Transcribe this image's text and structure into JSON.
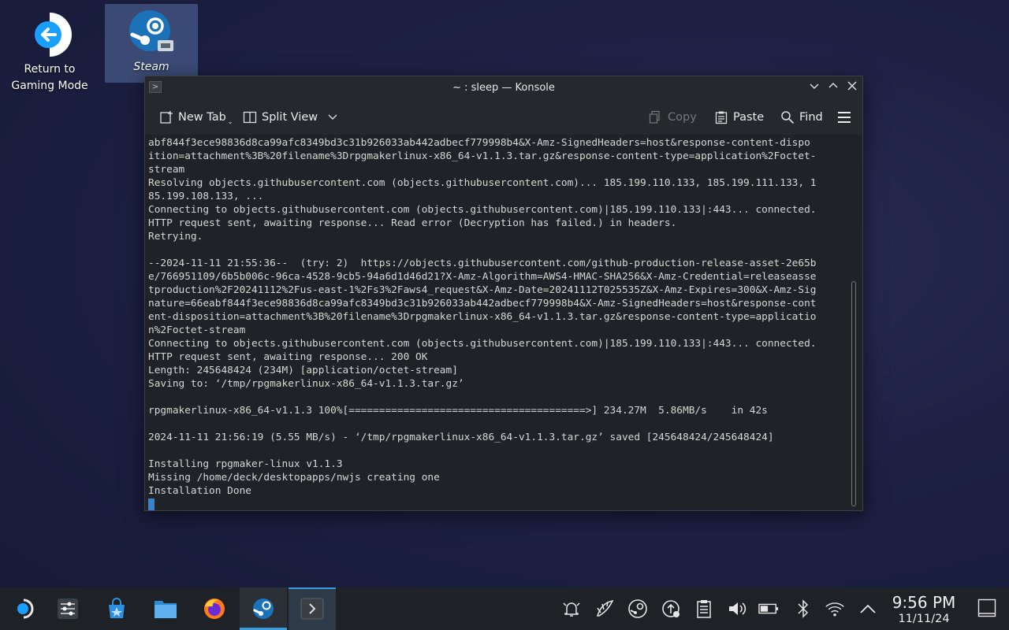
{
  "desktop": {
    "return_label_line1": "Return to",
    "return_label_line2": "Gaming Mode",
    "steam_label": "Steam"
  },
  "window": {
    "title": "~ : sleep — Konsole"
  },
  "toolbar": {
    "new_tab": "New Tab",
    "split_view": "Split View",
    "copy": "Copy",
    "paste": "Paste",
    "find": "Find"
  },
  "terminal": {
    "lines": [
      "abf844f3ece98836d8ca99afc8349bd3c31b926033ab442adbecf779998b4&X-Amz-SignedHeaders=host&response-content-dispo",
      "ition=attachment%3B%20filename%3Drpgmakerlinux-x86_64-v1.1.3.tar.gz&response-content-type=application%2Foctet-",
      "stream",
      "Resolving objects.githubusercontent.com (objects.githubusercontent.com)... 185.199.110.133, 185.199.111.133, 1",
      "85.199.108.133, ...",
      "Connecting to objects.githubusercontent.com (objects.githubusercontent.com)|185.199.110.133|:443... connected.",
      "HTTP request sent, awaiting response... Read error (Decryption has failed.) in headers.",
      "Retrying.",
      "",
      "--2024-11-11 21:55:36--  (try: 2)  https://objects.githubusercontent.com/github-production-release-asset-2e65b",
      "e/766951109/6b5b006c-96ca-4528-9cb5-94a6d1d46d21?X-Amz-Algorithm=AWS4-HMAC-SHA256&X-Amz-Credential=releaseasse",
      "tproduction%2F20241112%2Fus-east-1%2Fs3%2Faws4_request&X-Amz-Date=20241112T025535Z&X-Amz-Expires=300&X-Amz-Sig",
      "nature=66eabf844f3ece98836d8ca99afc8349bd3c31b926033ab442adbecf779998b4&X-Amz-SignedHeaders=host&response-cont",
      "ent-disposition=attachment%3B%20filename%3Drpgmakerlinux-x86_64-v1.1.3.tar.gz&response-content-type=applicatio",
      "n%2Foctet-stream",
      "Connecting to objects.githubusercontent.com (objects.githubusercontent.com)|185.199.110.133|:443... connected.",
      "HTTP request sent, awaiting response... 200 OK",
      "Length: 245648424 (234M) [application/octet-stream]",
      "Saving to: ‘/tmp/rpgmakerlinux-x86_64-v1.1.3.tar.gz’",
      "",
      "rpgmakerlinux-x86_64-v1.1.3 100%[=======================================>] 234.27M  5.86MB/s    in 42s",
      "",
      "2024-11-11 21:56:19 (5.55 MB/s) - ‘/tmp/rpgmakerlinux-x86_64-v1.1.3.tar.gz’ saved [245648424/245648424]",
      "",
      "Installing rpgmaker-linux v1.1.3",
      "Missing /home/deck/desktopapps/nwjs creating one",
      "Installation Done"
    ]
  },
  "taskbar": {
    "apps": [
      "steamos-menu-icon",
      "system-settings-icon",
      "discover-store-icon",
      "file-manager-icon",
      "firefox-icon",
      "steam-icon",
      "konsole-icon"
    ],
    "tray": [
      "notifications-icon",
      "kde-connect-icon",
      "steam-tray-icon",
      "update-icon",
      "clipboard-icon",
      "volume-icon",
      "battery-icon",
      "bluetooth-icon",
      "wifi-icon",
      "expand-tray-icon"
    ],
    "time": "9:56 PM",
    "date": "11/11/24"
  },
  "colors": {
    "accent": "#3b9ad9",
    "terminal_bg": "#1f2327",
    "terminal_fg": "#d6d6d6"
  }
}
